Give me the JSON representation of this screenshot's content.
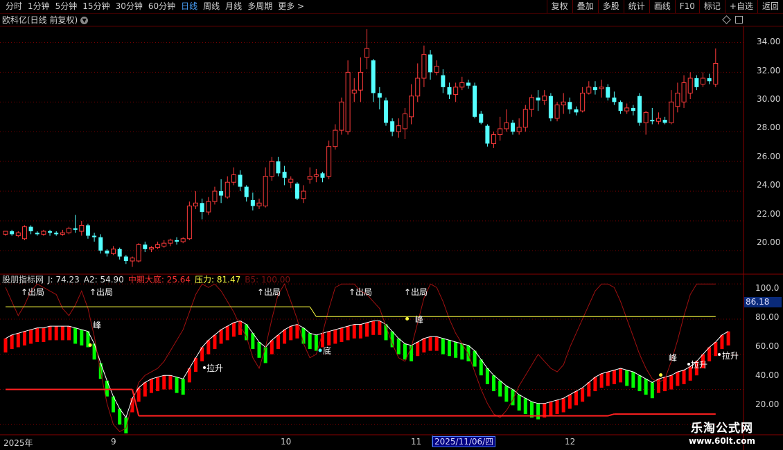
{
  "toolbar": {
    "periods": [
      "分时",
      "1分钟",
      "5分钟",
      "15分钟",
      "30分钟",
      "60分钟",
      "日线",
      "周线",
      "月线",
      "多周期",
      "更多 >"
    ],
    "active_period": "日线",
    "tools": [
      "复权",
      "叠加",
      "多股",
      "统计",
      "画线",
      "F10",
      "标记",
      "+自选",
      "返回"
    ]
  },
  "stock_title": "欧科亿(日线 前复权)",
  "price_axis": [
    "34.00",
    "32.00",
    "30.00",
    "28.00",
    "26.00",
    "24.00",
    "22.00",
    "20.00"
  ],
  "indicator": {
    "name": "股朋指标网",
    "values": [
      {
        "text": "J: 74.23",
        "color": "#e0e0e0"
      },
      {
        "text": "A2: 54.90",
        "color": "#e0e0e0"
      },
      {
        "text": "中期大底: 25.64",
        "color": "#ff3030"
      },
      {
        "text": "压力: 81.47",
        "color": "#ffff40"
      },
      {
        "text": "B5: 100.00",
        "color": "#7a1010"
      }
    ],
    "axis": [
      "100.0",
      "80.00",
      "60.00",
      "40.00",
      "20.00"
    ],
    "current_value": "86.18"
  },
  "annotations": {
    "chuju": "↑出局",
    "feng": "峰",
    "di": "底",
    "lasheng": "拉升"
  },
  "date_axis": [
    "2025年",
    "9",
    "10",
    "11",
    "12"
  ],
  "cursor_date": "2025/11/06/四",
  "watermark": {
    "line1": "乐淘公式网",
    "line2": "www.60lt.com"
  },
  "colors": {
    "up": "#ff3b3b",
    "down": "#54ffff",
    "bull": "#ff0000",
    "bear": "#00ff00",
    "grid": "#7a0000"
  },
  "chart_data": {
    "type": "candlestick",
    "candles": [
      [
        21.1,
        21.3,
        21.0,
        21.2
      ],
      [
        21.3,
        21.1,
        21.0,
        21.4
      ],
      [
        21.0,
        21.2,
        20.9,
        21.3
      ],
      [
        20.8,
        21.6,
        20.7,
        21.7
      ],
      [
        21.6,
        21.3,
        21.1,
        21.7
      ],
      [
        21.2,
        21.1,
        21.0,
        21.3
      ],
      [
        21.1,
        21.3,
        21.0,
        21.4
      ],
      [
        21.3,
        21.2,
        21.0,
        21.4
      ],
      [
        21.2,
        21.1,
        21.0,
        21.3
      ],
      [
        21.1,
        21.2,
        21.0,
        21.4
      ],
      [
        21.2,
        21.5,
        21.1,
        21.6
      ],
      [
        21.5,
        21.4,
        21.2,
        22.4
      ],
      [
        21.3,
        21.7,
        21.0,
        22.0
      ],
      [
        21.7,
        21.0,
        20.8,
        21.8
      ],
      [
        21.0,
        20.9,
        20.6,
        21.2
      ],
      [
        20.9,
        20.0,
        19.8,
        21.1
      ],
      [
        20.0,
        19.8,
        19.6,
        20.1
      ],
      [
        19.8,
        20.1,
        19.7,
        20.3
      ],
      [
        20.1,
        19.6,
        19.4,
        20.2
      ],
      [
        19.6,
        19.3,
        19.1,
        19.7
      ],
      [
        19.3,
        19.5,
        18.9,
        19.6
      ],
      [
        19.3,
        20.4,
        19.2,
        20.5
      ],
      [
        20.4,
        20.1,
        19.9,
        20.6
      ],
      [
        20.1,
        20.2,
        19.9,
        20.3
      ],
      [
        20.2,
        20.4,
        20.1,
        20.6
      ],
      [
        20.3,
        20.5,
        20.2,
        20.7
      ],
      [
        20.5,
        20.7,
        20.3,
        20.8
      ],
      [
        20.7,
        20.6,
        20.4,
        20.9
      ],
      [
        20.6,
        20.8,
        20.5,
        20.9
      ],
      [
        20.8,
        23.0,
        20.7,
        23.3
      ],
      [
        23.0,
        23.2,
        22.8,
        24.0
      ],
      [
        23.2,
        22.6,
        22.1,
        23.5
      ],
      [
        22.6,
        23.3,
        22.4,
        23.6
      ],
      [
        23.3,
        24.0,
        23.1,
        24.3
      ],
      [
        24.0,
        23.7,
        23.2,
        24.8
      ],
      [
        23.6,
        24.6,
        23.5,
        25.0
      ],
      [
        24.6,
        25.1,
        24.4,
        25.6
      ],
      [
        25.1,
        24.3,
        24.0,
        25.4
      ],
      [
        24.3,
        23.6,
        23.3,
        24.4
      ],
      [
        23.4,
        23.0,
        22.7,
        23.9
      ],
      [
        23.0,
        23.2,
        22.8,
        23.5
      ],
      [
        23.0,
        25.0,
        22.9,
        25.6
      ],
      [
        25.0,
        26.0,
        24.7,
        26.3
      ],
      [
        26.0,
        25.2,
        25.0,
        26.3
      ],
      [
        25.3,
        24.9,
        24.4,
        25.7
      ],
      [
        24.6,
        24.8,
        24.2,
        25.0
      ],
      [
        24.5,
        23.5,
        23.4,
        24.6
      ],
      [
        23.5,
        24.0,
        23.2,
        24.4
      ],
      [
        24.8,
        25.0,
        24.5,
        25.6
      ],
      [
        25.0,
        25.1,
        24.6,
        25.5
      ],
      [
        25.2,
        24.9,
        24.6,
        25.3
      ],
      [
        25.0,
        27.0,
        24.8,
        27.4
      ],
      [
        27.0,
        28.1,
        26.8,
        28.5
      ],
      [
        28.1,
        30.0,
        27.8,
        30.3
      ],
      [
        28.0,
        32.0,
        27.8,
        32.8
      ],
      [
        30.6,
        30.8,
        30.0,
        31.6
      ],
      [
        30.8,
        32.0,
        30.0,
        33.0
      ],
      [
        33.0,
        33.6,
        32.2,
        34.9
      ],
      [
        32.8,
        30.6,
        30.0,
        32.9
      ],
      [
        30.6,
        30.3,
        29.5,
        31.0
      ],
      [
        30.1,
        28.6,
        28.4,
        30.3
      ],
      [
        28.7,
        28.0,
        27.7,
        28.9
      ],
      [
        28.0,
        28.4,
        27.6,
        28.9
      ],
      [
        28.2,
        29.2,
        27.5,
        29.6
      ],
      [
        29.0,
        30.4,
        28.5,
        31.2
      ],
      [
        30.4,
        31.6,
        30.0,
        32.6
      ],
      [
        31.6,
        33.2,
        31.0,
        33.8
      ],
      [
        33.2,
        32.0,
        31.5,
        33.5
      ],
      [
        32.0,
        32.4,
        31.8,
        32.8
      ],
      [
        31.8,
        31.0,
        30.6,
        32.2
      ],
      [
        31.0,
        30.5,
        30.2,
        31.3
      ],
      [
        30.5,
        31.0,
        30.0,
        31.3
      ],
      [
        31.0,
        31.3,
        30.8,
        31.7
      ],
      [
        31.3,
        31.1,
        30.9,
        31.5
      ],
      [
        31.1,
        29.0,
        28.9,
        31.3
      ],
      [
        29.2,
        28.6,
        28.5,
        29.4
      ],
      [
        28.4,
        27.2,
        27.0,
        28.5
      ],
      [
        27.2,
        27.8,
        26.9,
        28.0
      ],
      [
        27.8,
        28.2,
        27.4,
        29.0
      ],
      [
        28.2,
        28.6,
        28.0,
        29.5
      ],
      [
        28.6,
        28.0,
        27.8,
        28.8
      ],
      [
        28.0,
        28.3,
        27.8,
        28.9
      ],
      [
        28.3,
        29.5,
        28.0,
        29.8
      ],
      [
        29.5,
        30.3,
        29.0,
        30.5
      ],
      [
        30.3,
        30.1,
        29.4,
        30.8
      ],
      [
        30.1,
        30.4,
        29.8,
        30.8
      ],
      [
        30.4,
        28.9,
        28.7,
        30.6
      ],
      [
        28.9,
        29.8,
        28.7,
        30.0
      ],
      [
        29.8,
        30.0,
        29.2,
        30.6
      ],
      [
        30.0,
        29.5,
        29.2,
        30.3
      ],
      [
        29.5,
        29.3,
        29.1,
        29.7
      ],
      [
        29.4,
        30.6,
        29.3,
        31.0
      ],
      [
        30.6,
        31.0,
        30.5,
        31.4
      ],
      [
        31.0,
        30.8,
        30.5,
        31.4
      ],
      [
        30.9,
        31.0,
        30.3,
        31.5
      ],
      [
        31.0,
        30.3,
        30.1,
        31.2
      ],
      [
        30.3,
        30.0,
        29.8,
        30.7
      ],
      [
        30.0,
        29.4,
        29.2,
        30.1
      ],
      [
        29.4,
        29.6,
        29.2,
        29.9
      ],
      [
        29.6,
        29.4,
        29.1,
        29.8
      ],
      [
        30.4,
        28.6,
        28.4,
        30.6
      ],
      [
        28.6,
        29.3,
        27.8,
        29.4
      ],
      [
        28.8,
        28.7,
        28.5,
        29.6
      ],
      [
        28.7,
        28.9,
        28.5,
        29.3
      ],
      [
        28.8,
        28.6,
        28.5,
        29.0
      ],
      [
        28.6,
        30.0,
        28.5,
        30.8
      ],
      [
        29.7,
        30.6,
        29.3,
        31.3
      ],
      [
        30.0,
        31.3,
        29.6,
        31.8
      ],
      [
        30.6,
        31.6,
        30.2,
        32.0
      ],
      [
        31.6,
        31.0,
        30.8,
        31.8
      ],
      [
        31.2,
        31.6,
        31.0,
        32.0
      ],
      [
        31.6,
        31.4,
        31.2,
        31.9
      ],
      [
        31.2,
        32.6,
        31.0,
        33.6
      ]
    ],
    "ylim": [
      18.6,
      35.0
    ],
    "indicator": {
      "ylim": [
        15,
        104
      ],
      "pressure_levels": [
        {
          "from": 0,
          "to": 48,
          "value": 87
        },
        {
          "from": 49,
          "to": 112,
          "value": 81.47
        }
      ],
      "bottom_levels": [
        {
          "from": 0,
          "to": 20,
          "value": 40
        },
        {
          "from": 21,
          "to": 95,
          "value": 25
        },
        {
          "from": 96,
          "to": 112,
          "value": 26
        }
      ],
      "a2": [
        69,
        71,
        72,
        73,
        74,
        75,
        75,
        76,
        76,
        76,
        76,
        75,
        74,
        73,
        66,
        55,
        45,
        36,
        29,
        24,
        35,
        41,
        44,
        46,
        47,
        48,
        48,
        47,
        46,
        52,
        58,
        64,
        68,
        71,
        74,
        76,
        78,
        79,
        77,
        72,
        67,
        64,
        68,
        71,
        74,
        76,
        77,
        75,
        72,
        71,
        72,
        73,
        74,
        75,
        76,
        77,
        77,
        78,
        79,
        79,
        77,
        73,
        69,
        66,
        65,
        67,
        69,
        70,
        70,
        69,
        68,
        67,
        66,
        65,
        62,
        57,
        52,
        48,
        45,
        42,
        40,
        37,
        35,
        33,
        32,
        32,
        33,
        34,
        35,
        37,
        39,
        41,
        44,
        47,
        49,
        50,
        51,
        52,
        51,
        50,
        48,
        46,
        44,
        46,
        47,
        48,
        50,
        51,
        53,
        56,
        60,
        64,
        67,
        71,
        73
      ],
      "j": [
        98,
        90,
        82,
        88,
        96,
        100,
        98,
        96,
        94,
        86,
        82,
        88,
        96,
        86,
        70,
        50,
        32,
        20,
        16,
        18,
        32,
        44,
        48,
        50,
        52,
        56,
        62,
        68,
        74,
        84,
        94,
        100,
        98,
        100,
        96,
        90,
        84,
        76,
        70,
        58,
        52,
        64,
        80,
        94,
        100,
        90,
        80,
        66,
        58,
        60,
        72,
        86,
        98,
        100,
        100,
        100,
        96,
        94,
        90,
        86,
        76,
        66,
        58,
        56,
        64,
        78,
        92,
        100,
        98,
        90,
        80,
        72,
        66,
        60,
        50,
        40,
        32,
        26,
        24,
        28,
        34,
        42,
        48,
        54,
        60,
        56,
        52,
        50,
        54,
        64,
        72,
        80,
        88,
        96,
        100,
        100,
        98,
        90,
        80,
        70,
        60,
        52,
        46,
        44,
        46,
        56,
        68,
        82,
        94,
        100,
        100,
        100,
        100
      ]
    }
  }
}
